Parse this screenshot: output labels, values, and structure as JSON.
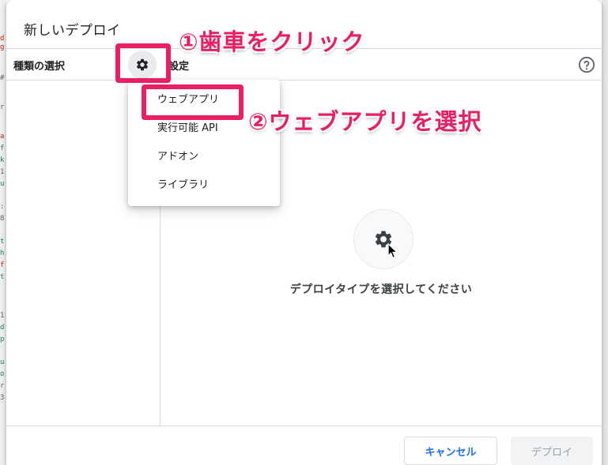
{
  "dialog": {
    "title": "新しいデプロイ",
    "select_type_label": "種類の選択",
    "settings_label": "設定",
    "empty_prompt": "デプロイタイプを選択してください"
  },
  "menu": {
    "items": [
      {
        "label": "ウェブアプリ"
      },
      {
        "label": "実行可能 API"
      },
      {
        "label": "アドオン"
      },
      {
        "label": "ライブラリ"
      }
    ]
  },
  "footer": {
    "cancel_label": "キャンセル",
    "deploy_label": "デプロイ"
  },
  "annotations": {
    "step1": "①歯車をクリック",
    "step2": "②ウェブアプリを選択"
  },
  "background_code": [
    "d",
    "g",
    "#",
    "r",
    "a",
    "f",
    "k",
    "1",
    "u",
    ":",
    "8",
    "t",
    "h",
    "f",
    "t",
    "1",
    "d",
    "p",
    "u",
    "o",
    "r",
    "3"
  ],
  "colors": {
    "highlight": "#e91e63",
    "accent": "#1a73e8",
    "divider": "#dadce0"
  },
  "icons": {
    "type_gear": "gear-icon",
    "help": "help-circle-icon",
    "center_gear": "gear-icon",
    "pointer": "mouse-pointer-icon"
  }
}
